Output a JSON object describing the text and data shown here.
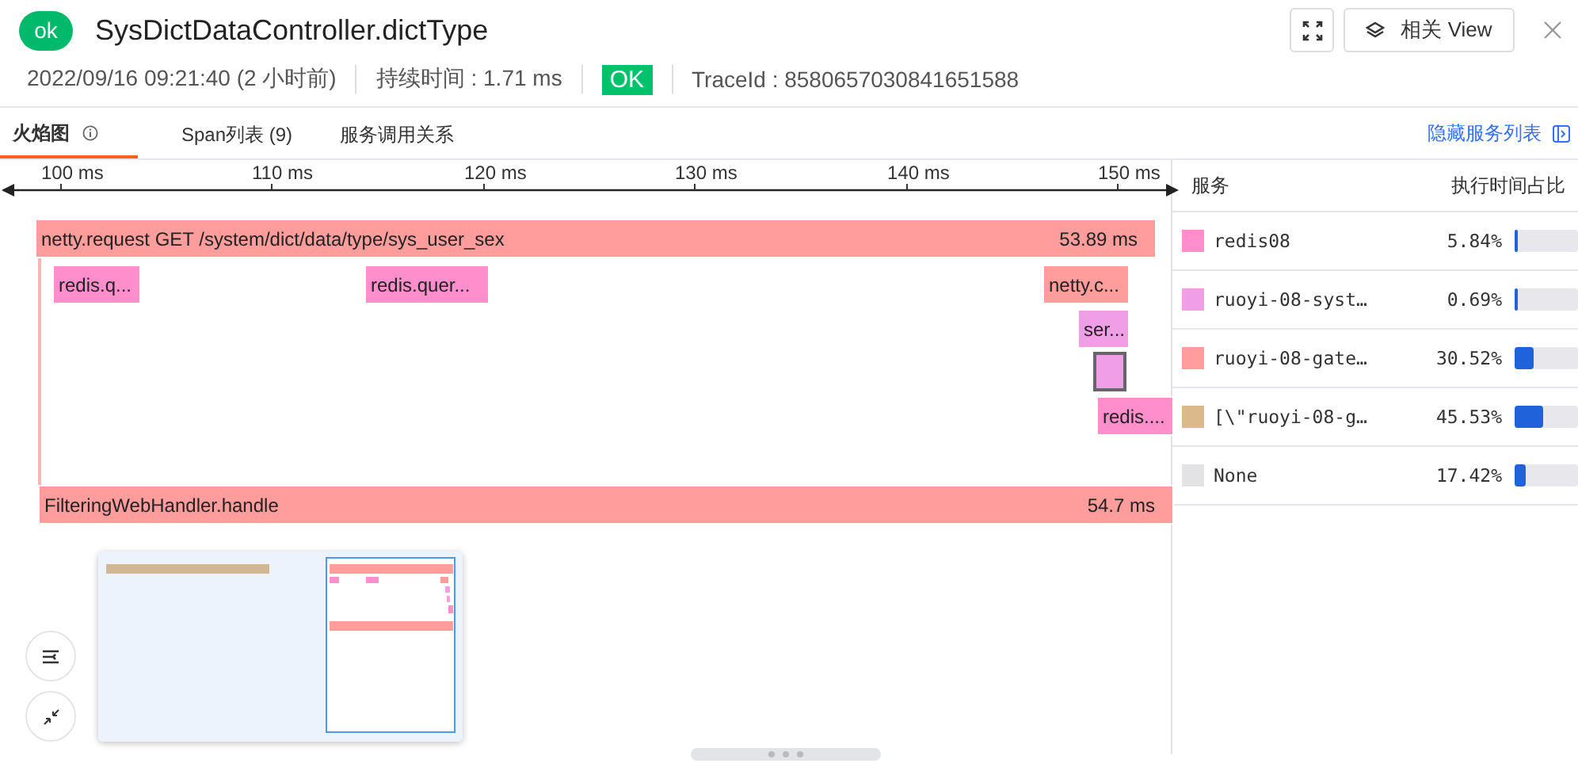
{
  "header": {
    "status_badge": "ok",
    "title": "SysDictDataController.dictType",
    "actions": [
      {
        "kind": "icon"
      },
      {
        "kind": "text",
        "label": "相关 View"
      },
      {
        "kind": "close"
      }
    ],
    "meta": [
      {
        "kind": "text",
        "text": "2022/09/16 09:21:40 (2 小时前)"
      },
      {
        "kind": "text",
        "text": "持续时间 : 1.71 ms"
      },
      {
        "kind": "badge",
        "text": "OK"
      },
      {
        "kind": "text",
        "text": "TraceId : 8580657030841651588"
      }
    ]
  },
  "tabs": [
    {
      "label": "火焰图",
      "selected": true,
      "info": true
    },
    {
      "label": "Span列表 (9)",
      "selected": false,
      "info": false
    },
    {
      "label": "服务调用关系",
      "selected": false,
      "info": false
    }
  ],
  "toggle_link": "隐藏服务列表",
  "axis": {
    "ticks": [
      "100 ms",
      "110 ms",
      "120 ms",
      "130 ms",
      "140 ms",
      "150 ms"
    ]
  },
  "spans": [
    {
      "name": "netty.request GET /system/dict/data/type/sys_user_sex",
      "duration": "53.89 ms",
      "color": "#ff9c9c",
      "selected": false
    },
    {
      "name": "redis.q...",
      "color": "#ff8fcc",
      "selected": false
    },
    {
      "name": "redis.quer...",
      "color": "#ff8fcc",
      "selected": false
    },
    {
      "name": "netty.c...",
      "color": "#ff9c9c",
      "selected": false
    },
    {
      "name": "ser...",
      "color": "#f09ee6",
      "selected": false
    },
    {
      "color": "#f09ee6",
      "selected": true
    },
    {
      "name": "redis....",
      "color": "#ff8fcc",
      "selected": false
    },
    {
      "name": "FilteringWebHandler.handle",
      "duration": "54.7 ms",
      "color": "#ff9c9c",
      "selected": false
    }
  ],
  "services": {
    "columns": [
      "服务",
      "执行时间占比"
    ],
    "rows": [
      {
        "name": "redis08",
        "percent": "5.84%",
        "level": 0.0584,
        "color": "#ff8fcc"
      },
      {
        "name": "ruoyi-08-syst…",
        "percent": "0.69%",
        "level": 0.0069,
        "color": "#f09ee6"
      },
      {
        "name": "ruoyi-08-gate…",
        "percent": "30.52%",
        "level": 0.3052,
        "color": "#ff9c9c"
      },
      {
        "name": "[\\\"ruoyi-08-g…",
        "percent": "45.53%",
        "level": 0.4553,
        "color": "#dbb98a"
      },
      {
        "name": "None",
        "percent": "17.42%",
        "level": 0.1742,
        "color": "#e3e3e6"
      }
    ]
  }
}
